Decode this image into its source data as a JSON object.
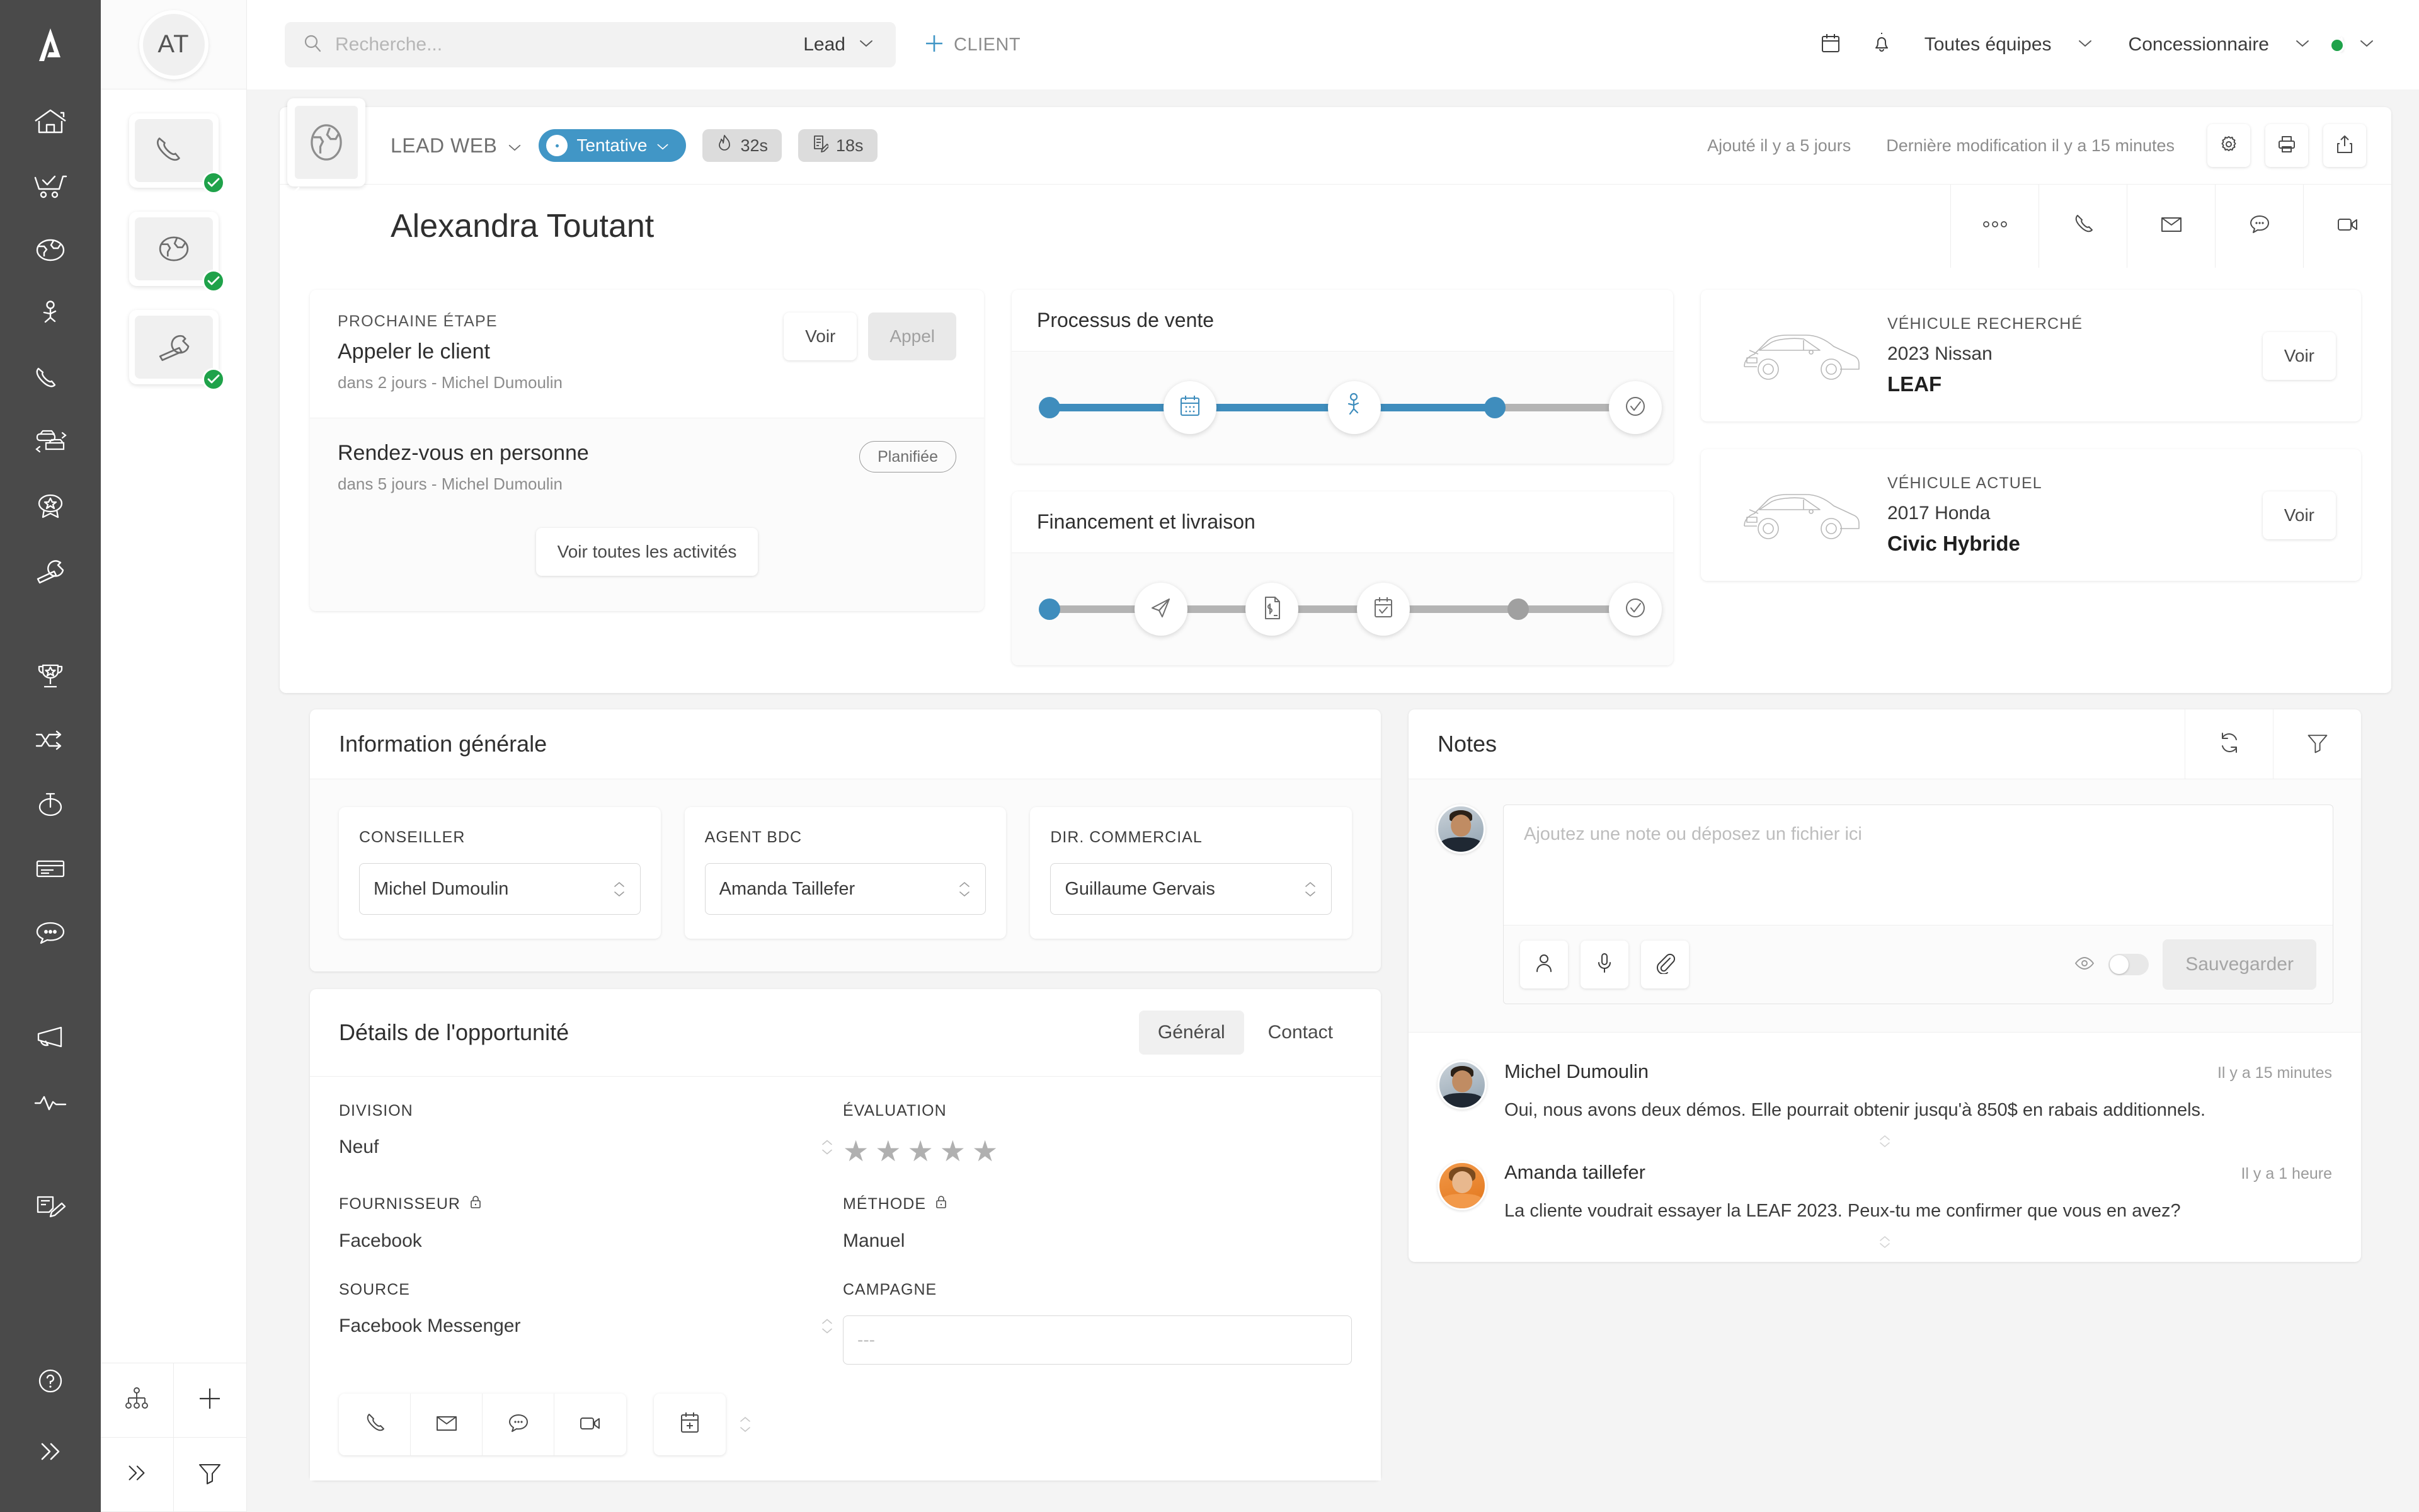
{
  "topbar": {
    "search_placeholder": "Recherche...",
    "search_scope": "Lead",
    "add_client_label": "CLIENT",
    "team_selector": "Toutes équipes",
    "role_selector": "Concessionnaire",
    "icons": [
      "calendar-icon",
      "bell-icon"
    ]
  },
  "rail": {
    "items": [
      {
        "name": "home-icon"
      },
      {
        "name": "sales-cart-icon"
      },
      {
        "name": "web-lead-globe-icon"
      },
      {
        "name": "walk-in-icon"
      },
      {
        "name": "phone-icon"
      },
      {
        "name": "trade-in-cars-icon"
      },
      {
        "name": "loyalty-badge-icon"
      },
      {
        "name": "service-wrench-icon"
      },
      {
        "name": "trophy-icon"
      },
      {
        "name": "shuffle-icon"
      },
      {
        "name": "stopwatch-icon"
      },
      {
        "name": "inventory-card-icon"
      },
      {
        "name": "chat-icon"
      },
      {
        "name": "megaphone-icon"
      },
      {
        "name": "pulse-icon"
      },
      {
        "name": "sign-document-icon"
      }
    ],
    "bottom": [
      {
        "name": "help-icon"
      },
      {
        "name": "expand-icon"
      }
    ]
  },
  "panel2": {
    "avatar_initials": "AT",
    "tiles": [
      {
        "name": "phone-tile",
        "icon": "phone-icon",
        "checked": true,
        "active": false
      },
      {
        "name": "web-tile",
        "icon": "globe-icon",
        "checked": true,
        "active": true
      },
      {
        "name": "service-tile",
        "icon": "wrench-icon",
        "checked": true,
        "active": false
      }
    ],
    "bottom_icons": [
      "org-tree-icon",
      "plus-icon",
      "expand-icon",
      "filter-icon"
    ]
  },
  "lead": {
    "type_label": "LEAD WEB",
    "status": "Tentative",
    "chips": [
      {
        "icon": "flame-icon",
        "value": "32s"
      },
      {
        "icon": "document-edit-icon",
        "value": "18s"
      }
    ],
    "added": "Ajouté il y a 5 jours",
    "modified": "Dernière modification il y a 15 minutes",
    "header_tools": [
      "gear-icon",
      "printer-icon",
      "share-icon"
    ],
    "name": "Alexandra Toutant",
    "name_actions": [
      "more-icon",
      "phone-icon",
      "mail-icon",
      "sms-icon",
      "video-icon"
    ]
  },
  "next_step": {
    "label": "PROCHAINE ÉTAPE",
    "title": "Appeler le client",
    "sub": "dans 2 jours - Michel Dumoulin",
    "btn_view": "Voir",
    "btn_call": "Appel",
    "second_title": "Rendez-vous en personne",
    "second_sub": "dans 5 jours - Michel Dumoulin",
    "second_badge": "Planifiée",
    "all_activities": "Voir toutes les activités"
  },
  "process_sale": {
    "title": "Processus de vente",
    "nodes": [
      {
        "name": "appointment-calendar-icon",
        "state": "done",
        "pos": 24
      },
      {
        "name": "walk-in-icon",
        "state": "done",
        "pos": 52
      },
      {
        "name": "check-circle-icon",
        "state": "pending",
        "pos": 100
      }
    ],
    "dots": [
      {
        "pos": 0,
        "state": "done"
      },
      {
        "pos": 76,
        "state": "done"
      }
    ],
    "progress_pct": 76
  },
  "process_finance": {
    "title": "Financement et livraison",
    "nodes": [
      {
        "name": "send-paperplane-icon",
        "state": "pending",
        "pos": 19
      },
      {
        "name": "finance-document-icon",
        "state": "pending",
        "pos": 38
      },
      {
        "name": "delivery-calendar-icon",
        "state": "pending",
        "pos": 57
      },
      {
        "name": "check-circle-icon",
        "state": "pending",
        "pos": 100
      }
    ],
    "dots": [
      {
        "pos": 0,
        "state": "done"
      },
      {
        "pos": 80,
        "state": "pending"
      }
    ],
    "progress_pct": 0
  },
  "vehicles": [
    {
      "label": "VÉHICULE RECHERCHÉ",
      "year_make": "2023 Nissan",
      "model": "LEAF",
      "btn": "Voir"
    },
    {
      "label": "VÉHICULE ACTUEL",
      "year_make": "2017 Honda",
      "model": "Civic Hybride",
      "btn": "Voir"
    }
  ],
  "general_info": {
    "title": "Information générale",
    "fields": [
      {
        "label": "CONSEILLER",
        "value": "Michel Dumoulin"
      },
      {
        "label": "AGENT BDC",
        "value": "Amanda Taillefer"
      },
      {
        "label": "DIR. COMMERCIAL",
        "value": "Guillaume Gervais"
      }
    ]
  },
  "opportunity": {
    "title": "Détails de l'opportunité",
    "tabs": [
      {
        "label": "Général",
        "selected": true
      },
      {
        "label": "Contact",
        "selected": false
      }
    ],
    "division_label": "DIVISION",
    "division_value": "Neuf",
    "evaluation_label": "ÉVALUATION",
    "evaluation_stars": 5,
    "evaluation_filled": 0,
    "supplier_label": "FOURNISSEUR",
    "supplier_value": "Facebook",
    "method_label": "MÉTHODE",
    "method_value": "Manuel",
    "source_label": "SOURCE",
    "source_value": "Facebook Messenger",
    "campaign_label": "CAMPAGNE",
    "campaign_value": "---",
    "actions": [
      "phone-icon",
      "mail-icon",
      "sms-icon",
      "video-icon",
      "add-calendar-icon"
    ]
  },
  "notes": {
    "title": "Notes",
    "head_icons": [
      "refresh-icon",
      "filter-icon"
    ],
    "compose_placeholder": "Ajoutez une note ou déposez un fichier ici",
    "compose_icons": [
      "person-icon",
      "microphone-icon",
      "attachment-icon"
    ],
    "visibility_icon": "eye-icon",
    "save_label": "Sauvegarder",
    "items": [
      {
        "author": "Michel Dumoulin",
        "time": "Il y a 15 minutes",
        "text": "Oui, nous avons deux démos. Elle pourrait obtenir jusqu'à 850$ en rabais additionnels.",
        "avatar": "m"
      },
      {
        "author": "Amanda taillefer",
        "time": "Il y a 1 heure",
        "text": "La cliente voudrait essayer la LEAF 2023. Peux-tu me confirmer que vous en avez?",
        "avatar": "f"
      }
    ]
  },
  "colors": {
    "accent_blue": "#4196c6",
    "rail_dark": "#4a4a4a",
    "green": "#1fa24a",
    "track_gray": "#b4b4b4",
    "page_bg": "#f4f4f4"
  }
}
